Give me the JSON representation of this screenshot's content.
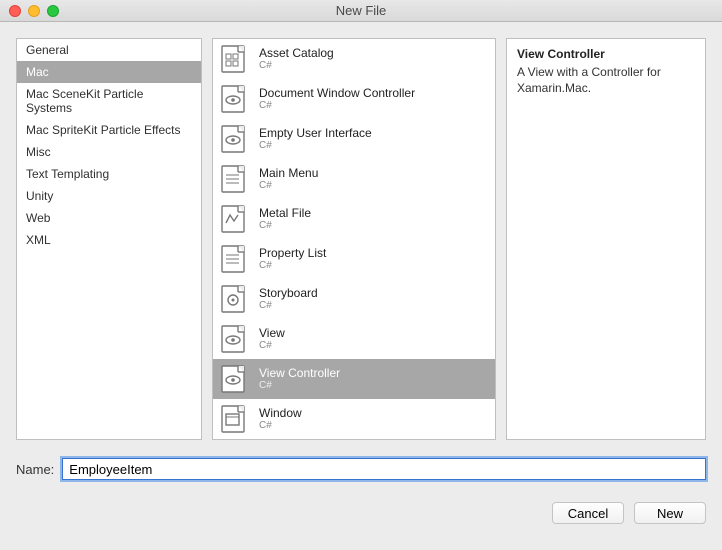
{
  "window_title": "New File",
  "categories": [
    {
      "label": "General",
      "selected": false
    },
    {
      "label": "Mac",
      "selected": true
    },
    {
      "label": "Mac SceneKit Particle Systems",
      "selected": false
    },
    {
      "label": "Mac SpriteKit Particle Effects",
      "selected": false
    },
    {
      "label": "Misc",
      "selected": false
    },
    {
      "label": "Text Templating",
      "selected": false
    },
    {
      "label": "Unity",
      "selected": false
    },
    {
      "label": "Web",
      "selected": false
    },
    {
      "label": "XML",
      "selected": false
    }
  ],
  "templates": [
    {
      "name": "Asset Catalog",
      "sub": "C#",
      "icon": "grid",
      "selected": false
    },
    {
      "name": "Document Window Controller",
      "sub": "C#",
      "icon": "eye",
      "selected": false
    },
    {
      "name": "Empty User Interface",
      "sub": "C#",
      "icon": "eye",
      "selected": false
    },
    {
      "name": "Main Menu",
      "sub": "C#",
      "icon": "lines",
      "selected": false
    },
    {
      "name": "Metal File",
      "sub": "C#",
      "icon": "metal",
      "selected": false
    },
    {
      "name": "Property List",
      "sub": "C#",
      "icon": "lines",
      "selected": false
    },
    {
      "name": "Storyboard",
      "sub": "C#",
      "icon": "story",
      "selected": false
    },
    {
      "name": "View",
      "sub": "C#",
      "icon": "eye",
      "selected": false
    },
    {
      "name": "View Controller",
      "sub": "C#",
      "icon": "eye",
      "selected": true
    },
    {
      "name": "Window",
      "sub": "C#",
      "icon": "window",
      "selected": false
    }
  ],
  "detail": {
    "title": "View Controller",
    "body": "A View with a Controller for Xamarin.Mac."
  },
  "name_field": {
    "label": "Name:",
    "value": "EmployeeItem"
  },
  "buttons": {
    "cancel": "Cancel",
    "new": "New"
  }
}
